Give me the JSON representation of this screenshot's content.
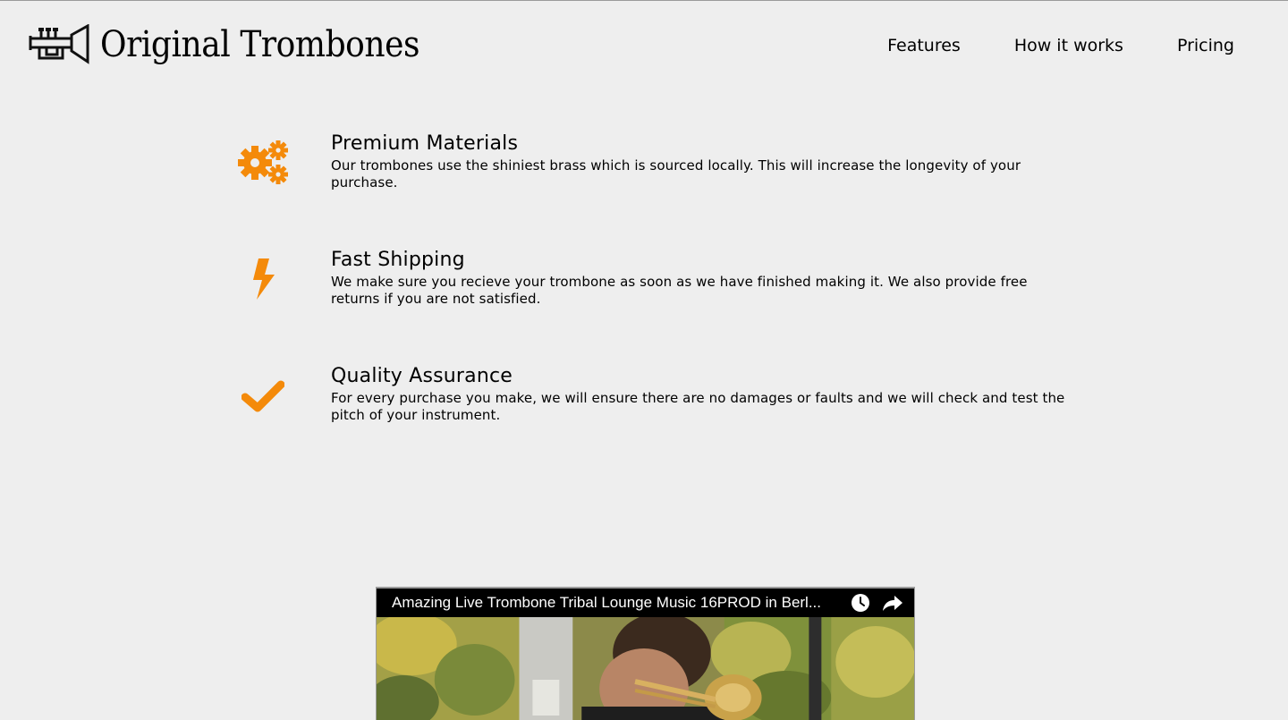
{
  "header": {
    "brand": "Original Trombones",
    "logo_icon": "trumpet-icon",
    "nav": [
      {
        "label": "Features"
      },
      {
        "label": "How it works"
      },
      {
        "label": "Pricing"
      }
    ]
  },
  "features": [
    {
      "icon": "gears-icon",
      "title": "Premium Materials",
      "description": "Our trombones use the shiniest brass which is sourced locally. This will increase the longevity of your purchase."
    },
    {
      "icon": "lightning-icon",
      "title": "Fast Shipping",
      "description": "We make sure you recieve your trombone as soon as we have finished making it. We also provide free returns if you are not satisfied."
    },
    {
      "icon": "check-icon",
      "title": "Quality Assurance",
      "description": "For every purchase you make, we will ensure there are no damages or faults and we will check and test the pitch of your instrument."
    }
  ],
  "video": {
    "title": "Amazing Live Trombone Tribal Lounge Music 16PROD in Berl...",
    "controls": [
      "clock-icon",
      "share-icon"
    ]
  },
  "colors": {
    "accent": "#f48a0a",
    "background": "#eeeeee"
  }
}
